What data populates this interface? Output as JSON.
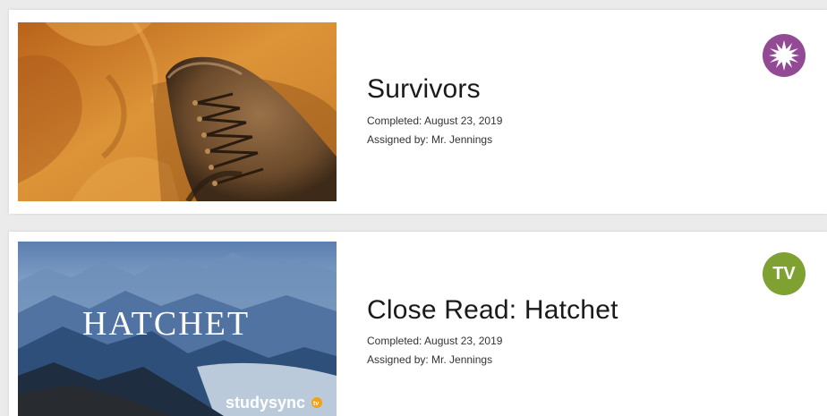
{
  "assignments": [
    {
      "title": "Survivors",
      "completed": "Completed: August 23, 2019",
      "assigned_by": "Assigned by: Mr. Jennings",
      "thumbnail": "boot-in-desert-sand",
      "badge_icon": "starburst-icon",
      "badge_color": "#924a95"
    },
    {
      "title": "Close Read: Hatchet",
      "completed": "Completed: August 23, 2019",
      "assigned_by": "Assigned by: Mr. Jennings",
      "thumbnail": "misty-mountains",
      "thumbnail_title": "HATCHET",
      "thumbnail_brand": "studysync",
      "thumbnail_brand_suffix": "tv",
      "badge_label": "TV",
      "badge_color": "#7ea132"
    }
  ]
}
